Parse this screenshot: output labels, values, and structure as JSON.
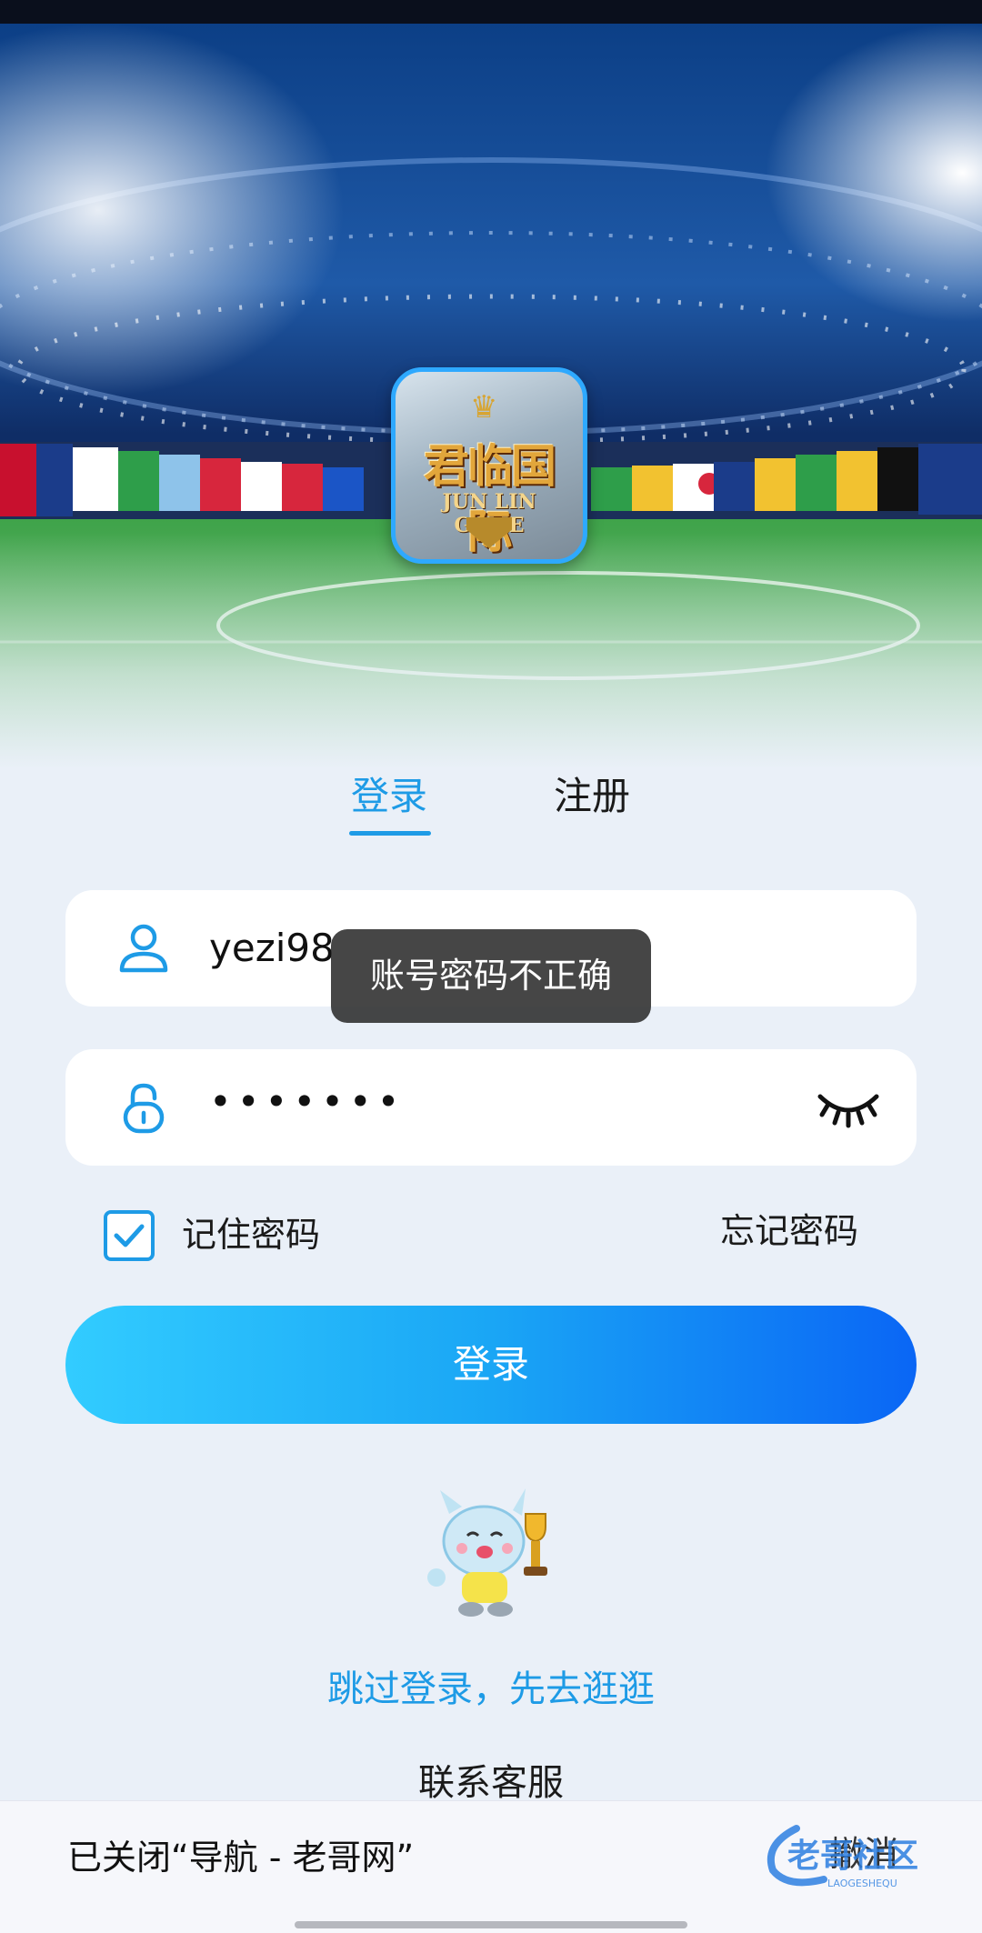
{
  "logo": {
    "text_cn": "君临国际",
    "text_en": "JUN LIN GAME"
  },
  "tabs": {
    "login": "登录",
    "register": "注册"
  },
  "form": {
    "username": "yezi98",
    "password_masked": "•••••••",
    "remember_label": "记住密码",
    "remember_checked": true,
    "forgot_label": "忘记密码",
    "submit_label": "登录"
  },
  "toast": {
    "message": "账号密码不正确"
  },
  "links": {
    "skip": "跳过登录，先去逛逛",
    "service": "联系客服"
  },
  "snackbar": {
    "message": "已关闭“导航 - 老哥网”",
    "action": "撤消"
  },
  "watermark": {
    "text_cn": "老哥社区",
    "text_en": "LAOGESHEQU"
  },
  "colors": {
    "accent": "#1e9be6",
    "button_start": "#32ccff",
    "button_end": "#0a66f5",
    "toast_bg": "#323232"
  },
  "icons": [
    "user-icon",
    "lock-icon",
    "eye-closed-icon",
    "check-icon",
    "mascot-dragon-icon"
  ]
}
